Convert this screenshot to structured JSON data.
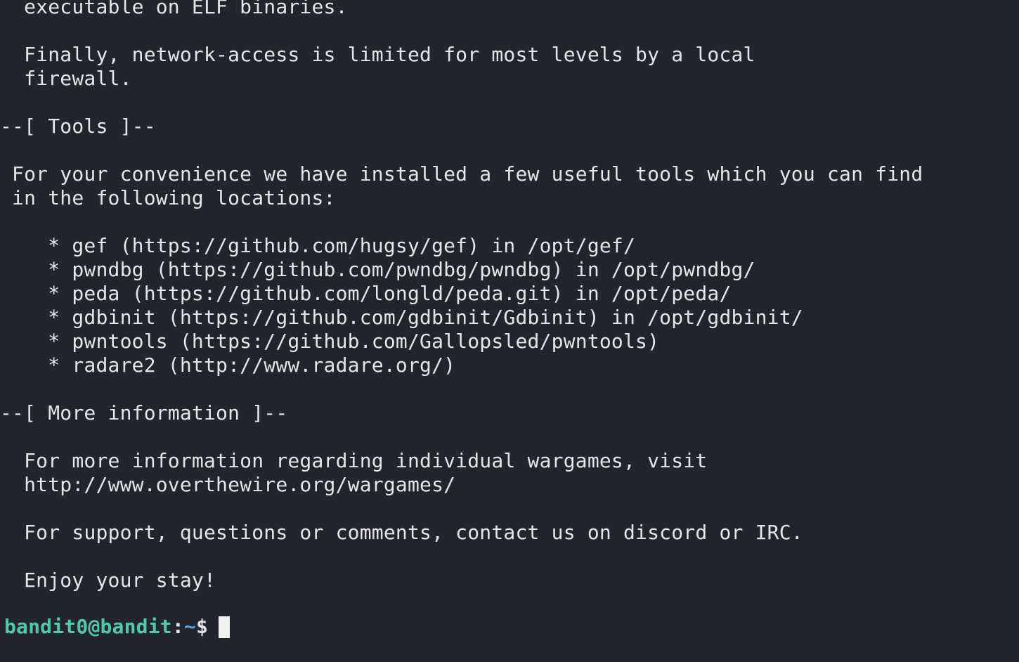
{
  "terminal": {
    "lines": [
      "  executable on ELF binaries.",
      "",
      "  Finally, network-access is limited for most levels by a local",
      "  firewall.",
      "",
      "--[ Tools ]--",
      "",
      " For your convenience we have installed a few useful tools which you can find",
      " in the following locations:",
      "",
      "    * gef (https://github.com/hugsy/gef) in /opt/gef/",
      "    * pwndbg (https://github.com/pwndbg/pwndbg) in /opt/pwndbg/",
      "    * peda (https://github.com/longld/peda.git) in /opt/peda/",
      "    * gdbinit (https://github.com/gdbinit/Gdbinit) in /opt/gdbinit/",
      "    * pwntools (https://github.com/Gallopsled/pwntools)",
      "    * radare2 (http://www.radare.org/)",
      "",
      "--[ More information ]--",
      "",
      "  For more information regarding individual wargames, visit",
      "  http://www.overthewire.org/wargames/",
      "",
      "  For support, questions or comments, contact us on discord or IRC.",
      "",
      "  Enjoy your stay!",
      ""
    ],
    "prompt": {
      "user_host": "bandit0@bandit",
      "separator": ":",
      "path": "~",
      "symbol": "$ "
    }
  },
  "colors": {
    "background": "#22252c",
    "text": "#e6e6e6",
    "prompt_user": "#4ec9b0",
    "prompt_path": "#5aa2e0"
  }
}
